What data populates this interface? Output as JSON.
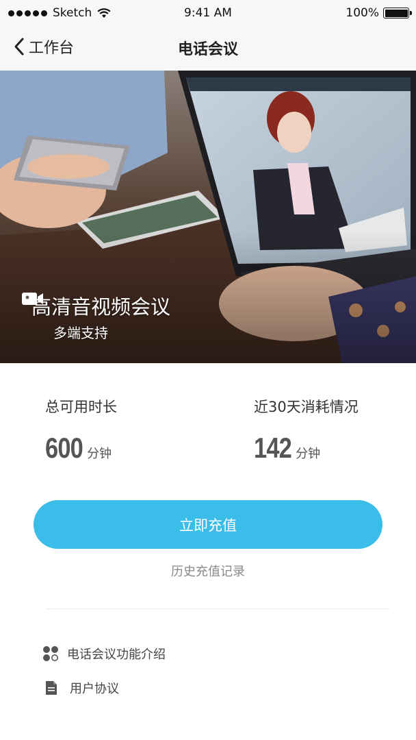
{
  "status_bar": {
    "carrier": "Sketch",
    "time": "9:41 AM",
    "battery": "100%"
  },
  "nav": {
    "back_label": "工作台",
    "title": "电话会议"
  },
  "hero": {
    "title": "高清音视频会议",
    "subtitle": "多端支持",
    "icon": "video-camera-icon"
  },
  "stats": {
    "total": {
      "label": "总可用时长",
      "value": "600",
      "unit": "分钟"
    },
    "recent": {
      "label": "近30天消耗情况",
      "value": "142",
      "unit": "分钟"
    }
  },
  "actions": {
    "recharge_label": "立即充值",
    "history_label": "历史充值记录"
  },
  "links": [
    {
      "label": "电话会议功能介绍",
      "icon": "grid-dots-icon"
    },
    {
      "label": "用户协议",
      "icon": "document-icon"
    }
  ],
  "colors": {
    "accent": "#3bbde9",
    "nav_bg": "#f7f7f7"
  }
}
